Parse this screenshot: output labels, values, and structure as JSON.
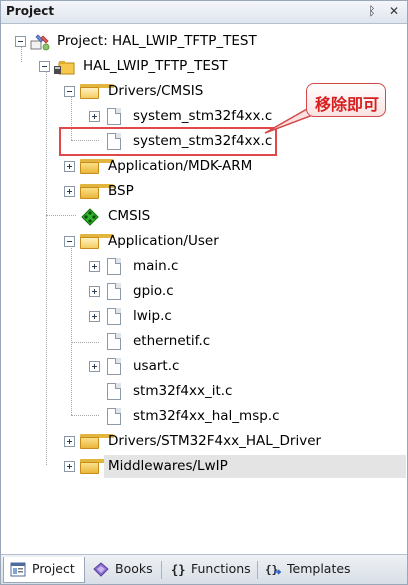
{
  "panel": {
    "title": "Project",
    "pin_glyph": "ᛒ",
    "close_glyph": "✕"
  },
  "tree": {
    "project_root": "Project: HAL_LWIP_TFTP_TEST",
    "target": "HAL_LWIP_TFTP_TEST",
    "group_drivers_cmsis": "Drivers/CMSIS",
    "file_system_a": "system_stm32f4xx.c",
    "file_system_b": "system_stm32f4xx.c",
    "group_app_mdk": "Application/MDK-ARM",
    "group_bsp": "BSP",
    "cmsis_component": "CMSIS",
    "group_app_user": "Application/User",
    "files_user": [
      "main.c",
      "gpio.c",
      "lwip.c",
      "ethernetif.c",
      "usart.c",
      "stm32f4xx_it.c",
      "stm32f4xx_hal_msp.c"
    ],
    "group_hal_driver": "Drivers/STM32F4xx_HAL_Driver",
    "group_middlewares": "Middlewares/LwIP"
  },
  "annotation": {
    "callout_text": "移除即可",
    "highlight_color": "#e2474a"
  },
  "tabs": [
    {
      "label": "Project",
      "icon": "project-tab-icon",
      "active": true
    },
    {
      "label": "Books",
      "icon": "books-icon",
      "active": false
    },
    {
      "label": "Functions",
      "icon": "braces-icon",
      "active": false
    },
    {
      "label": "Templates",
      "icon": "template-icon",
      "active": false
    }
  ],
  "colors": {
    "folder": "#eab63a",
    "annotation": "#d61f1f",
    "cmsis_gem": "#2fb52c"
  }
}
